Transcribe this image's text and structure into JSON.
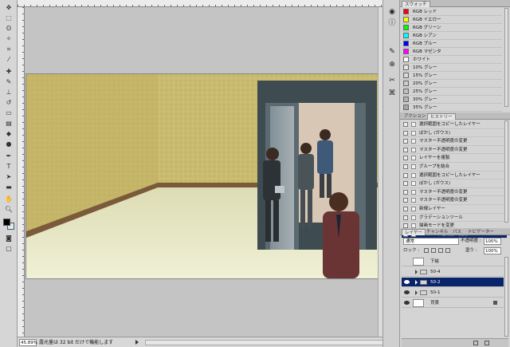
{
  "status": {
    "zoom": "45.89%",
    "message": "露光量は 32 bit だけで機能します"
  },
  "swatches_panel": {
    "tab_label": "スウォッチ",
    "items": [
      {
        "name": "RGB レッド",
        "color": "#ff0000"
      },
      {
        "name": "RGB イエロー",
        "color": "#ffff00"
      },
      {
        "name": "RGB グリーン",
        "color": "#00ff00"
      },
      {
        "name": "RGB シアン",
        "color": "#00ffff"
      },
      {
        "name": "RGB ブルー",
        "color": "#0000ff"
      },
      {
        "name": "RGB マゼンタ",
        "color": "#ff00ff"
      },
      {
        "name": "ホワイト",
        "color": "#ffffff"
      },
      {
        "name": "10% グレー",
        "color": "#e6e6e6"
      },
      {
        "name": "15% グレー",
        "color": "#d9d9d9"
      },
      {
        "name": "20% グレー",
        "color": "#cccccc"
      },
      {
        "name": "25% グレー",
        "color": "#bfbfbf"
      },
      {
        "name": "30% グレー",
        "color": "#b3b3b3"
      },
      {
        "name": "35% グレー",
        "color": "#a6a6a6"
      }
    ]
  },
  "history_panel": {
    "tabs": [
      "アクション",
      "ヒストリー"
    ],
    "items": [
      "選択範囲をコピーしたレイヤー",
      "ぼかし (ガウス)",
      "マスター不透明度の変更",
      "マスター不透明度の変更",
      "レイヤーを複製",
      "グループを結合",
      "選択範囲をコピーしたレイヤー",
      "ぼかし (ガウス)",
      "マスター不透明度の変更",
      "マスター不透明度の変更",
      "新規レイヤー",
      "グラデーションツール",
      "描画モードを変更",
      "マスター不透明度の変更"
    ],
    "selected_index": 13
  },
  "layers_panel": {
    "tabs": [
      "レイヤー",
      "チャンネル",
      "パス",
      "ナビゲーター"
    ],
    "blend_mode": "通常",
    "opacity_label": "不透明度 :",
    "opacity_value": "100%",
    "lock_label": "ロック :",
    "fill_label": "塗り :",
    "fill_value": "100%",
    "layers": [
      {
        "name": "下絵",
        "type": "layer",
        "visible": false
      },
      {
        "name": "50-4",
        "type": "group",
        "visible": false
      },
      {
        "name": "50-2",
        "type": "group",
        "visible": true,
        "selected": true
      },
      {
        "name": "50-1",
        "type": "group",
        "visible": true
      },
      {
        "name": "背景",
        "type": "background",
        "visible": true
      }
    ]
  }
}
